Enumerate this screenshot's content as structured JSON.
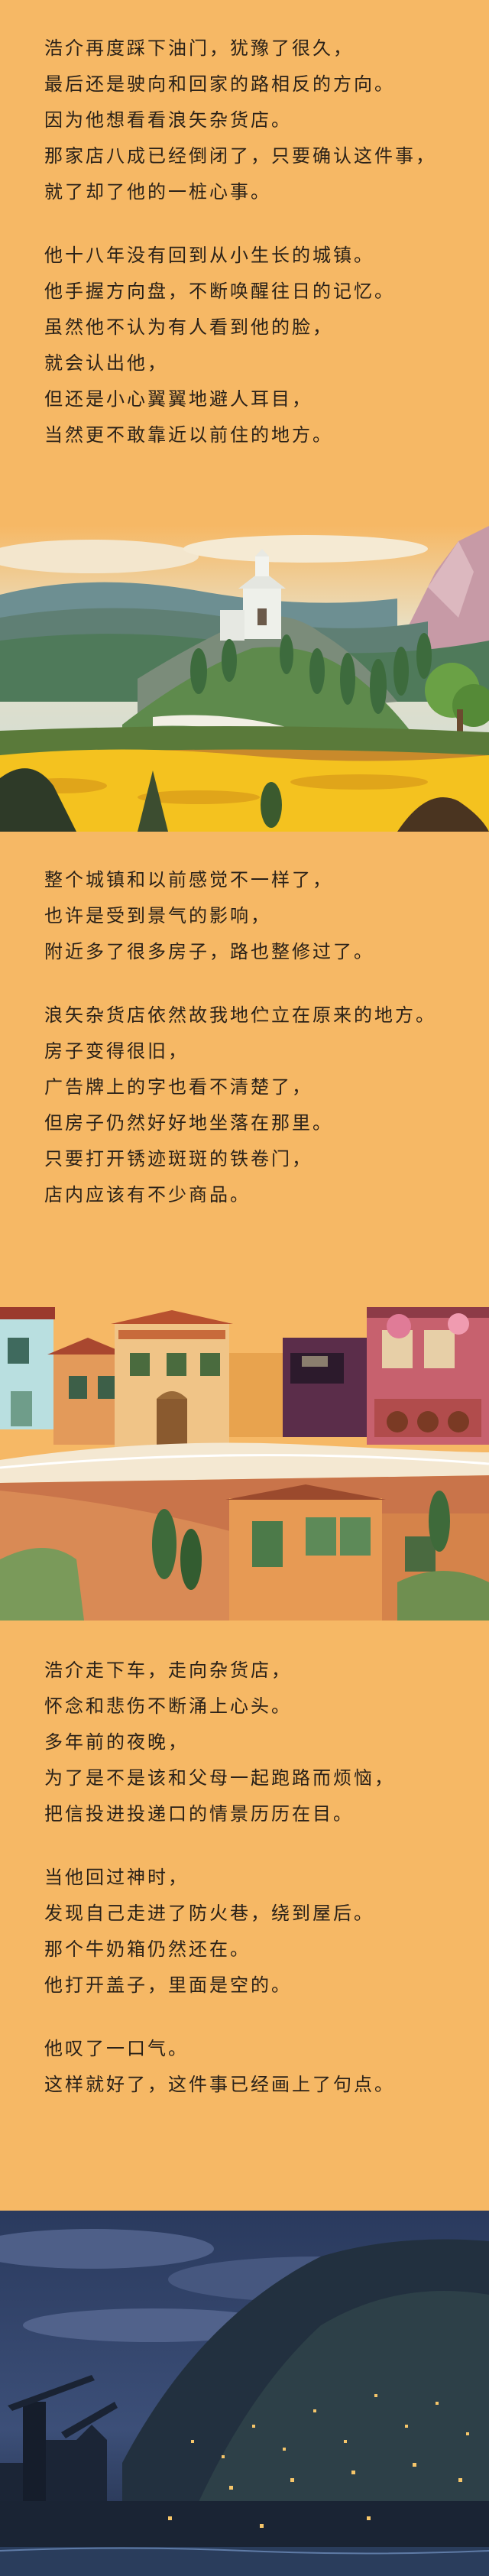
{
  "story": {
    "block1": {
      "p1": [
        "浩介再度踩下油门，犹豫了很久，",
        "最后还是驶向和回家的路相反的方向。",
        "因为他想看看浪矢杂货店。",
        "那家店八成已经倒闭了，只要确认这件事，",
        "就了却了他的一桩心事。"
      ],
      "p2": [
        "他十八年没有回到从小生长的城镇。",
        "他手握方向盘，不断唤醒往日的记忆。",
        "虽然他不认为有人看到他的脸，",
        "就会认出他，",
        "但还是小心翼翼地避人耳目，",
        "当然更不敢靠近以前住的地方。"
      ]
    },
    "block2": {
      "p1": [
        "整个城镇和以前感觉不一样了，",
        "也许是受到景气的影响，",
        "附近多了很多房子，路也整修过了。"
      ],
      "p2": [
        "浪矢杂货店依然故我地伫立在原来的地方。",
        "房子变得很旧，",
        "广告牌上的字也看不清楚了，",
        "但房子仍然好好地坐落在那里。",
        "只要打开锈迹斑斑的铁卷门，",
        "店内应该有不少商品。"
      ]
    },
    "block3": {
      "p1": [
        "浩介走下车，走向杂货店，",
        "怀念和悲伤不断涌上心头。",
        "多年前的夜晚，",
        "为了是不是该和父母一起跑路而烦恼，",
        "把信投进投递口的情景历历在目。"
      ],
      "p2": [
        "当他回过神时，",
        "发现自己走进了防火巷，绕到屋后。",
        "那个牛奶箱仍然还在。",
        "他打开盖子，里面是空的。"
      ],
      "p3": [
        "他叹了一口气。",
        "这样就好了，这件事已经画上了句点。"
      ]
    }
  },
  "colors": {
    "background": "#f6b865",
    "text": "#2a2118"
  },
  "illustrations": [
    "mountain-chapel-illustration",
    "town-street-illustration",
    "night-harbor-illustration"
  ]
}
